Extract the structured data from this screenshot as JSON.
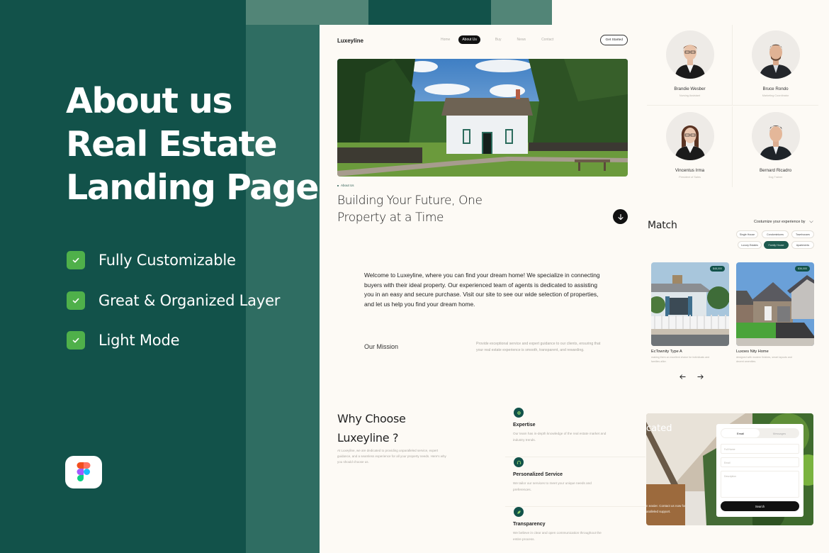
{
  "promo": {
    "title_lines": [
      "About us",
      "Real Estate",
      "Landing Page"
    ],
    "features": [
      "Fully Customizable",
      "Great & Organized Layer",
      "Light Mode"
    ],
    "tool_badge_icon": "figma-icon",
    "accent_green": "#4fb04a",
    "background": "#12524a"
  },
  "site": {
    "brand": "Luxeyline",
    "nav": [
      "Home",
      "About Us",
      "Buy",
      "News",
      "Contact"
    ],
    "nav_active": "About Us",
    "cta": "Get Started",
    "hero_image": "white-house-in-meadow-photo",
    "eyebrow": "About Us",
    "headline_lines": [
      "Building Your Future, One",
      "Property at a Time"
    ],
    "scroll_icon": "arrow-down-icon",
    "intro": "Welcome to Luxeyline, where you can find your dream home! We specialize in connecting buyers with their ideal property. Our experienced team of agents is dedicated to assisting you in an easy and secure purchase. Visit our site to see our wide selection of properties, and let us help you find your dream home.",
    "mission": {
      "label": "Our Mission",
      "text": "Provide exceptional service and expert guidance to our clients, ensuring that your real estate experience is smooth, transparent, and rewarding."
    },
    "why": {
      "title_lines": [
        "Why Choose",
        "Luxeyline ?"
      ],
      "text": "At Luxeyline, we are dedicated to providing unparalleled service, expert guidance, and a seamless experience for all your property needs. Here's why you should choose us.",
      "reasons": [
        {
          "title": "Expertise",
          "desc": "Our team has in-depth knowledge of the real estate market and industry trends.",
          "icon": "badge-icon"
        },
        {
          "title": "Personalized Service",
          "desc": "We tailor our services to meet your unique needs and preferences.",
          "icon": "headset-icon"
        },
        {
          "title": "Transparency",
          "desc": "We believe in clear and open communication throughout the entire process.",
          "icon": "leaf-icon"
        }
      ]
    }
  },
  "team": [
    {
      "name": "Brandie Wesber",
      "role": "Nursing Assistant"
    },
    {
      "name": "Bruce Rondo",
      "role": "Marketing Coordinator"
    },
    {
      "name": "Vincentus Irma",
      "role": "President of Sales"
    },
    {
      "name": "Bernard Ricadro",
      "role": "Dog Trainer"
    }
  ],
  "match": {
    "title": "Match",
    "customize_label": "Costumize your experience by",
    "chips": [
      "Single House",
      "Condominiums",
      "Townhouses",
      "Luxury Estates",
      "Family House",
      "Apartments"
    ],
    "active_chip": "Family House",
    "listings": [
      {
        "title": "EcTownity Type A",
        "desc": "making them an excellent choice for individuals and families alike.",
        "price": "$48,000"
      },
      {
        "title": "Luxoes Nity Home",
        "desc": "designed with modern finishes, smart layouts and decent amenities.",
        "price": "$36,000"
      }
    ],
    "prev_icon": "arrow-left-icon",
    "next_icon": "arrow-right-icon"
  },
  "contact": {
    "heading_fragment": "cated",
    "sub_lines": [
      "n easier. Contact us now for",
      "aralleled support."
    ],
    "tabs": [
      "Email",
      "Messages"
    ],
    "active_tab": "Email",
    "fields": [
      {
        "placeholder": "Full Name"
      },
      {
        "placeholder": "Email"
      },
      {
        "placeholder": "Description"
      }
    ],
    "submit": "Search"
  }
}
